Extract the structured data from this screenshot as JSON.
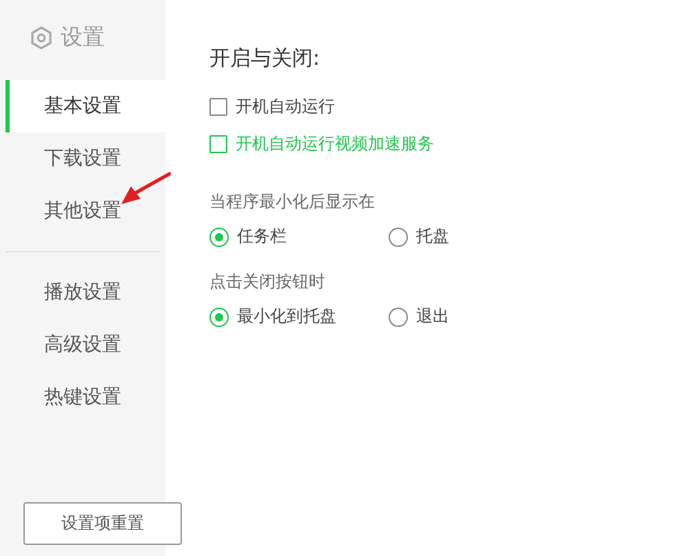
{
  "sidebar": {
    "title": "设置",
    "items": [
      {
        "label": "基本设置",
        "selected": true
      },
      {
        "label": "下载设置",
        "selected": false
      },
      {
        "label": "其他设置",
        "selected": false
      },
      {
        "kind": "divider"
      },
      {
        "label": "播放设置",
        "selected": false
      },
      {
        "label": "高级设置",
        "selected": false
      },
      {
        "label": "热键设置",
        "selected": false
      }
    ],
    "reset_button": "设置项重置"
  },
  "main": {
    "heading": "开启与关闭:",
    "checkboxes": [
      {
        "label": "开机自动运行",
        "checked": false,
        "hovered": false
      },
      {
        "label": "开机自动运行视频加速服务",
        "checked": false,
        "hovered": true
      }
    ],
    "groups": [
      {
        "label": "当程序最小化后显示在",
        "options": [
          {
            "label": "任务栏",
            "selected": true
          },
          {
            "label": "托盘",
            "selected": false
          }
        ]
      },
      {
        "label": "点击关闭按钮时",
        "options": [
          {
            "label": "最小化到托盘",
            "selected": true
          },
          {
            "label": "退出",
            "selected": false
          }
        ]
      }
    ]
  }
}
